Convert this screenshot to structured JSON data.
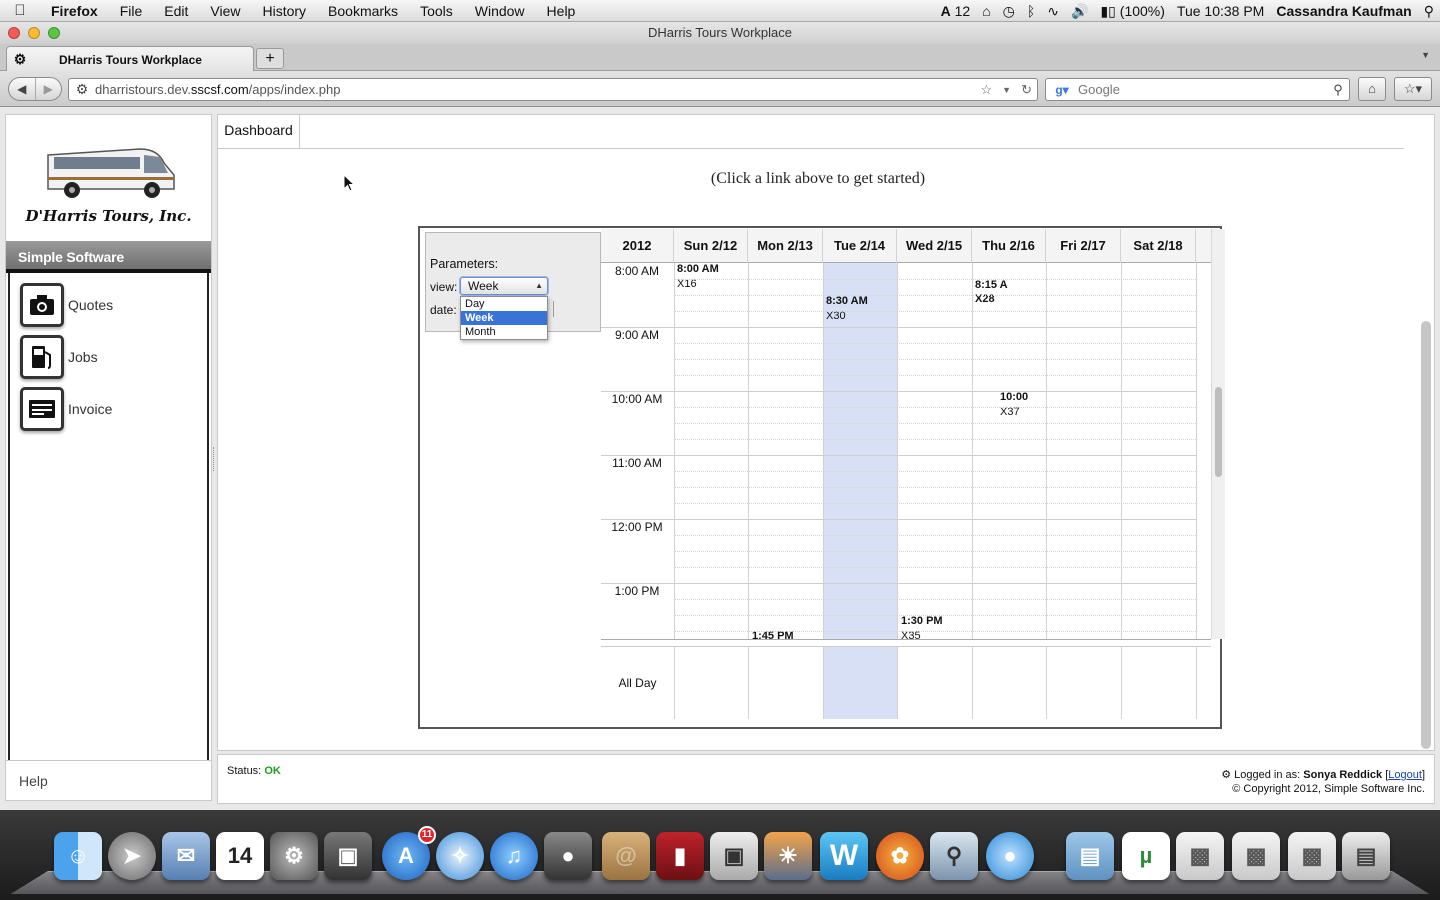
{
  "menubar": {
    "app_name": "Firefox",
    "items": [
      "File",
      "Edit",
      "View",
      "History",
      "Bookmarks",
      "Tools",
      "Window",
      "Help"
    ],
    "status": {
      "adobe_count": "12",
      "battery": "(100%)",
      "clock": "Tue 10:38 PM",
      "user": "Cassandra Kaufman"
    }
  },
  "window": {
    "title": "DHarris Tours Workplace"
  },
  "tabs": {
    "active_label": "DHarris Tours Workplace"
  },
  "toolbar": {
    "url_prefix": "dharristours.dev.",
    "url_domain": "sscsf.com",
    "url_path": "/apps/index.php",
    "search_placeholder": "Google"
  },
  "sidebar": {
    "brand": "D'Harris Tours, Inc.",
    "section_title": "Simple Software",
    "items": [
      {
        "label": "Quotes",
        "icon": "camera-icon"
      },
      {
        "label": "Jobs",
        "icon": "fuel-pump-icon"
      },
      {
        "label": "Invoice",
        "icon": "invoice-icon"
      }
    ],
    "help_label": "Help"
  },
  "main": {
    "tab_label": "Dashboard",
    "prompt": "(Click a link above to get started)"
  },
  "calendar": {
    "params_title": "Parameters:",
    "view_label": "view:",
    "view_value": "Week",
    "view_options": [
      "Day",
      "Week",
      "Month"
    ],
    "date_label": "date:",
    "year": "2012",
    "days": [
      "Sun 2/12",
      "Mon 2/13",
      "Tue 2/14",
      "Wed 2/15",
      "Thu 2/16",
      "Fri 2/17",
      "Sat 2/18"
    ],
    "today_index": 2,
    "hours": [
      "8:00 AM",
      "9:00 AM",
      "10:00 AM",
      "11:00 AM",
      "12:00 PM",
      "1:00 PM"
    ],
    "all_day_label": "All Day",
    "events": [
      {
        "time": "8:00 AM",
        "id": "X16",
        "day": 0
      },
      {
        "time": "8:30 AM",
        "id": "X30",
        "day": 2
      },
      {
        "time": "8:15 A",
        "id": "X28",
        "day": 4
      },
      {
        "time": "10:00",
        "id": "X37",
        "day": 4
      },
      {
        "time": "1:30 PM",
        "id": "X35",
        "day": 3
      },
      {
        "time": "1:45 PM",
        "id": "",
        "day": 1
      }
    ]
  },
  "status": {
    "label": "Status:",
    "value": "OK",
    "logged_in_prefix": "Logged in as:",
    "user": "Sonya Reddick",
    "logout": "Logout",
    "copyright": "© Copyright 2012, Simple Software Inc."
  },
  "dock": {
    "apps": [
      "Finder",
      "Launchpad",
      "Mail",
      "Calendar",
      "System Preferences",
      "Image Capture",
      "App Store",
      "Safari",
      "iTunes",
      "FaceTime",
      "Address Book",
      "Photo Booth",
      "Preview",
      "iPhoto",
      "Word",
      "Firefox",
      "Photo Browser",
      "Messages",
      "Documents",
      "uTorrent",
      "Window 1",
      "Window 2",
      "Window 3",
      "Trash"
    ],
    "app_store_badge": "11",
    "calendar_day": "14"
  }
}
